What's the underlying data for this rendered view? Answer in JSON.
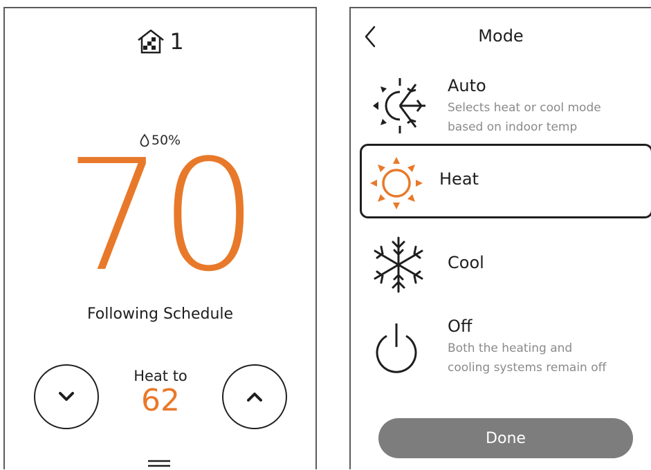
{
  "thermostat": {
    "zone_number": "1",
    "humidity": "50%",
    "current_temp": "70",
    "status": "Following Schedule",
    "setpoint_label": "Heat to",
    "setpoint_value": "62",
    "icons": {
      "zone": "house-icon",
      "humidity": "water-drop-icon",
      "decrease": "chevron-down-icon",
      "increase": "chevron-up-icon",
      "menu": "menu-icon"
    },
    "accent_color": "#e8792a"
  },
  "mode_screen": {
    "title": "Mode",
    "back_icon": "chevron-left-icon",
    "selected": "Heat",
    "items": [
      {
        "label": "Auto",
        "description": "Selects heat or cool mode\nbased on indoor temp",
        "icon": "auto-sun-snowflake-icon"
      },
      {
        "label": "Heat",
        "description": "",
        "icon": "sun-icon"
      },
      {
        "label": "Cool",
        "description": "",
        "icon": "snowflake-icon"
      },
      {
        "label": "Off",
        "description": "Both the heating and\ncooling systems remain off",
        "icon": "power-icon"
      }
    ],
    "done_label": "Done",
    "done_color": "#7d7d7d"
  }
}
